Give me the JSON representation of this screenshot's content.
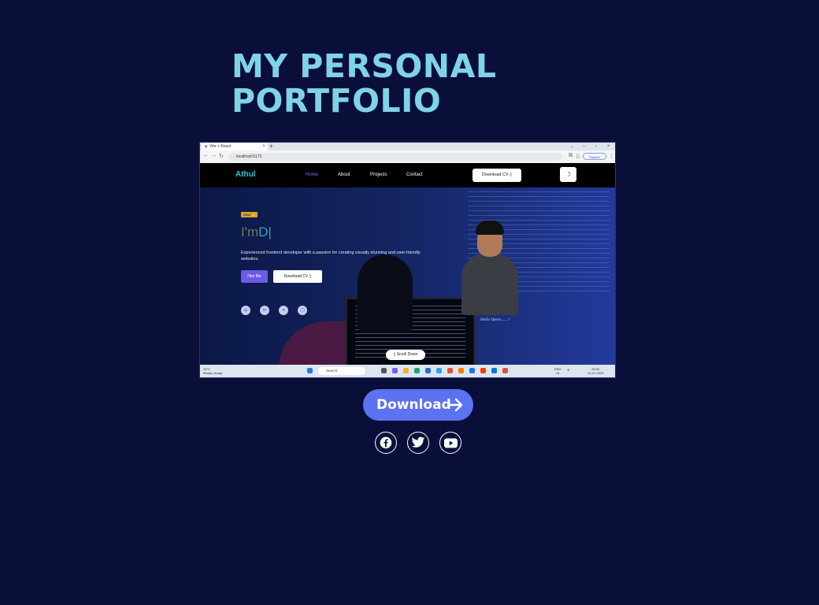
{
  "page": {
    "title_line1": "MY PERSONAL",
    "title_line2": "PORTFOLIO"
  },
  "screenshot": {
    "browser": {
      "tab_title": "Vite + React",
      "url": "localhost:5173",
      "profile_label": "Paused"
    },
    "site": {
      "brand": "Athul",
      "nav": [
        "Home",
        "About",
        "Projects",
        "Contact"
      ],
      "download_cv": "Download CV",
      "theme_toggle": "☽"
    },
    "hero": {
      "badge": "Athul ✨",
      "typing_prefix": "I'm",
      "typing_text": "D|",
      "description": "Experienced frontend developer with a passion for creating visually stunning and user-friendly websites.",
      "hire_label": "Hire Me",
      "cv_label": "Download CV",
      "caption": "Hello there.......!",
      "scroll_label": "Scroll Down"
    },
    "taskbar": {
      "weather_temp": "23°C",
      "weather_desc": "Mostly cloudy",
      "search": "Search",
      "lang": "ENG",
      "lang_sub": "IN",
      "time": "09:33",
      "date": "12-12-2023"
    }
  },
  "actions": {
    "download_label": "Download"
  },
  "social_icons": [
    "facebook-icon",
    "twitter-icon",
    "youtube-icon"
  ],
  "colors": {
    "background": "#0a0f3a",
    "title": "#7fd3e6",
    "download_button": "#5b73f0"
  }
}
